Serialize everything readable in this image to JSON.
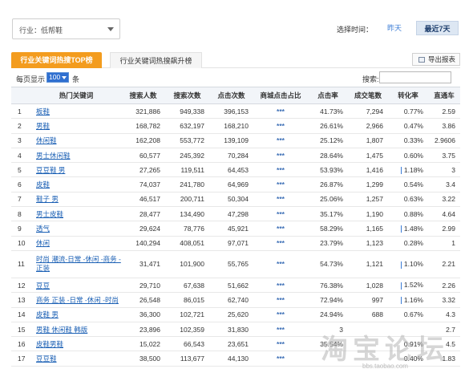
{
  "filters": {
    "industry": "行业：低帮鞋",
    "time_label": "选择时间：",
    "yesterday": "昨天",
    "last7": "最近7天"
  },
  "tabs": [
    {
      "label": "行业关键词热搜TOP榜",
      "active": true
    },
    {
      "label": "行业关键词热搜飙升榜",
      "active": false
    }
  ],
  "export_label": "导出报表",
  "pager": {
    "pre": "每页显示",
    "value": "100",
    "post": "条",
    "search_label": "搜索:"
  },
  "table": {
    "headers": [
      "",
      "热门关键词",
      "搜索人数",
      "搜索次数",
      "点击次数",
      "商城点击占比",
      "点击率",
      "成交笔数",
      "转化率",
      "直通车"
    ],
    "rows": [
      {
        "idx": "1",
        "kw": "板鞋",
        "a": "321,886",
        "b": "949,338",
        "c": "396,153",
        "s": "***",
        "ctr": "41.73%",
        "deals": "7,294",
        "conv": "0.77%",
        "ztc": "2.59",
        "bar": false
      },
      {
        "idx": "2",
        "kw": "男鞋",
        "a": "168,782",
        "b": "632,197",
        "c": "168,210",
        "s": "***",
        "ctr": "26.61%",
        "deals": "2,966",
        "conv": "0.47%",
        "ztc": "3.86",
        "bar": false
      },
      {
        "idx": "3",
        "kw": "休闲鞋",
        "a": "162,208",
        "b": "553,772",
        "c": "139,109",
        "s": "***",
        "ctr": "25.12%",
        "deals": "1,807",
        "conv": "0.33%",
        "ztc": "2.9606",
        "bar": false
      },
      {
        "idx": "4",
        "kw": "男士休闲鞋",
        "a": "60,577",
        "b": "245,392",
        "c": "70,284",
        "s": "***",
        "ctr": "28.64%",
        "deals": "1,475",
        "conv": "0.60%",
        "ztc": "3.75",
        "bar": false
      },
      {
        "idx": "5",
        "kw": "豆豆鞋 男",
        "a": "27,265",
        "b": "119,511",
        "c": "64,453",
        "s": "***",
        "ctr": "53.93%",
        "deals": "1,416",
        "conv": "1.18%",
        "ztc": "3",
        "bar": true
      },
      {
        "idx": "6",
        "kw": "皮鞋",
        "a": "74,037",
        "b": "241,780",
        "c": "64,969",
        "s": "***",
        "ctr": "26.87%",
        "deals": "1,299",
        "conv": "0.54%",
        "ztc": "3.4",
        "bar": false
      },
      {
        "idx": "7",
        "kw": "鞋子 男",
        "a": "46,517",
        "b": "200,711",
        "c": "50,304",
        "s": "***",
        "ctr": "25.06%",
        "deals": "1,257",
        "conv": "0.63%",
        "ztc": "3.22",
        "bar": false
      },
      {
        "idx": "8",
        "kw": "男士皮鞋",
        "a": "28,477",
        "b": "134,490",
        "c": "47,298",
        "s": "***",
        "ctr": "35.17%",
        "deals": "1,190",
        "conv": "0.88%",
        "ztc": "4.64",
        "bar": false
      },
      {
        "idx": "9",
        "kw": "透气",
        "a": "29,624",
        "b": "78,776",
        "c": "45,921",
        "s": "***",
        "ctr": "58.29%",
        "deals": "1,165",
        "conv": "1.48%",
        "ztc": "2.99",
        "bar": true
      },
      {
        "idx": "10",
        "kw": "休闲",
        "a": "140,294",
        "b": "408,051",
        "c": "97,071",
        "s": "***",
        "ctr": "23.79%",
        "deals": "1,123",
        "conv": "0.28%",
        "ztc": "1",
        "bar": false
      },
      {
        "idx": "11",
        "kw": "时尚 潮流-日常 -休闲 -商务 -正装",
        "a": "31,471",
        "b": "101,900",
        "c": "55,765",
        "s": "***",
        "ctr": "54.73%",
        "deals": "1,121",
        "conv": "1.10%",
        "ztc": "2.21",
        "bar": true,
        "tall": true
      },
      {
        "idx": "12",
        "kw": "豆豆",
        "a": "29,710",
        "b": "67,638",
        "c": "51,662",
        "s": "***",
        "ctr": "76.38%",
        "deals": "1,028",
        "conv": "1.52%",
        "ztc": "2.26",
        "bar": true
      },
      {
        "idx": "13",
        "kw": "商务 正装 -日常 -休闲 -时尚",
        "a": "26,548",
        "b": "86,015",
        "c": "62,740",
        "s": "***",
        "ctr": "72.94%",
        "deals": "997",
        "conv": "1.16%",
        "ztc": "3.32",
        "bar": true
      },
      {
        "idx": "14",
        "kw": "皮鞋 男",
        "a": "36,300",
        "b": "102,721",
        "c": "25,620",
        "s": "***",
        "ctr": "24.94%",
        "deals": "688",
        "conv": "0.67%",
        "ztc": "4.3",
        "bar": false
      },
      {
        "idx": "15",
        "kw": "男鞋 休闲鞋 韩版",
        "a": "23,896",
        "b": "102,359",
        "c": "31,830",
        "s": "***",
        "ctr": "3",
        "deals": "",
        "conv": "",
        "ztc": "2.7",
        "bar": false
      },
      {
        "idx": "16",
        "kw": "皮鞋男鞋",
        "a": "15,022",
        "b": "66,543",
        "c": "23,651",
        "s": "***",
        "ctr": "35.54%",
        "deals": "",
        "conv": "0.91%",
        "ztc": "4.5",
        "bar": false
      },
      {
        "idx": "17",
        "kw": "豆豆鞋",
        "a": "38,500",
        "b": "113,677",
        "c": "44,130",
        "s": "***",
        "ctr": "",
        "deals": "",
        "conv": "0.40%",
        "ztc": "1.83",
        "bar": false
      }
    ]
  },
  "watermark": {
    "text": "淘宝论坛",
    "url": "bbs.taobao.com"
  },
  "colors": {
    "tab_active": "#f39c1e",
    "link": "#1a5fb4",
    "header_bg": "#f2f5f9"
  }
}
